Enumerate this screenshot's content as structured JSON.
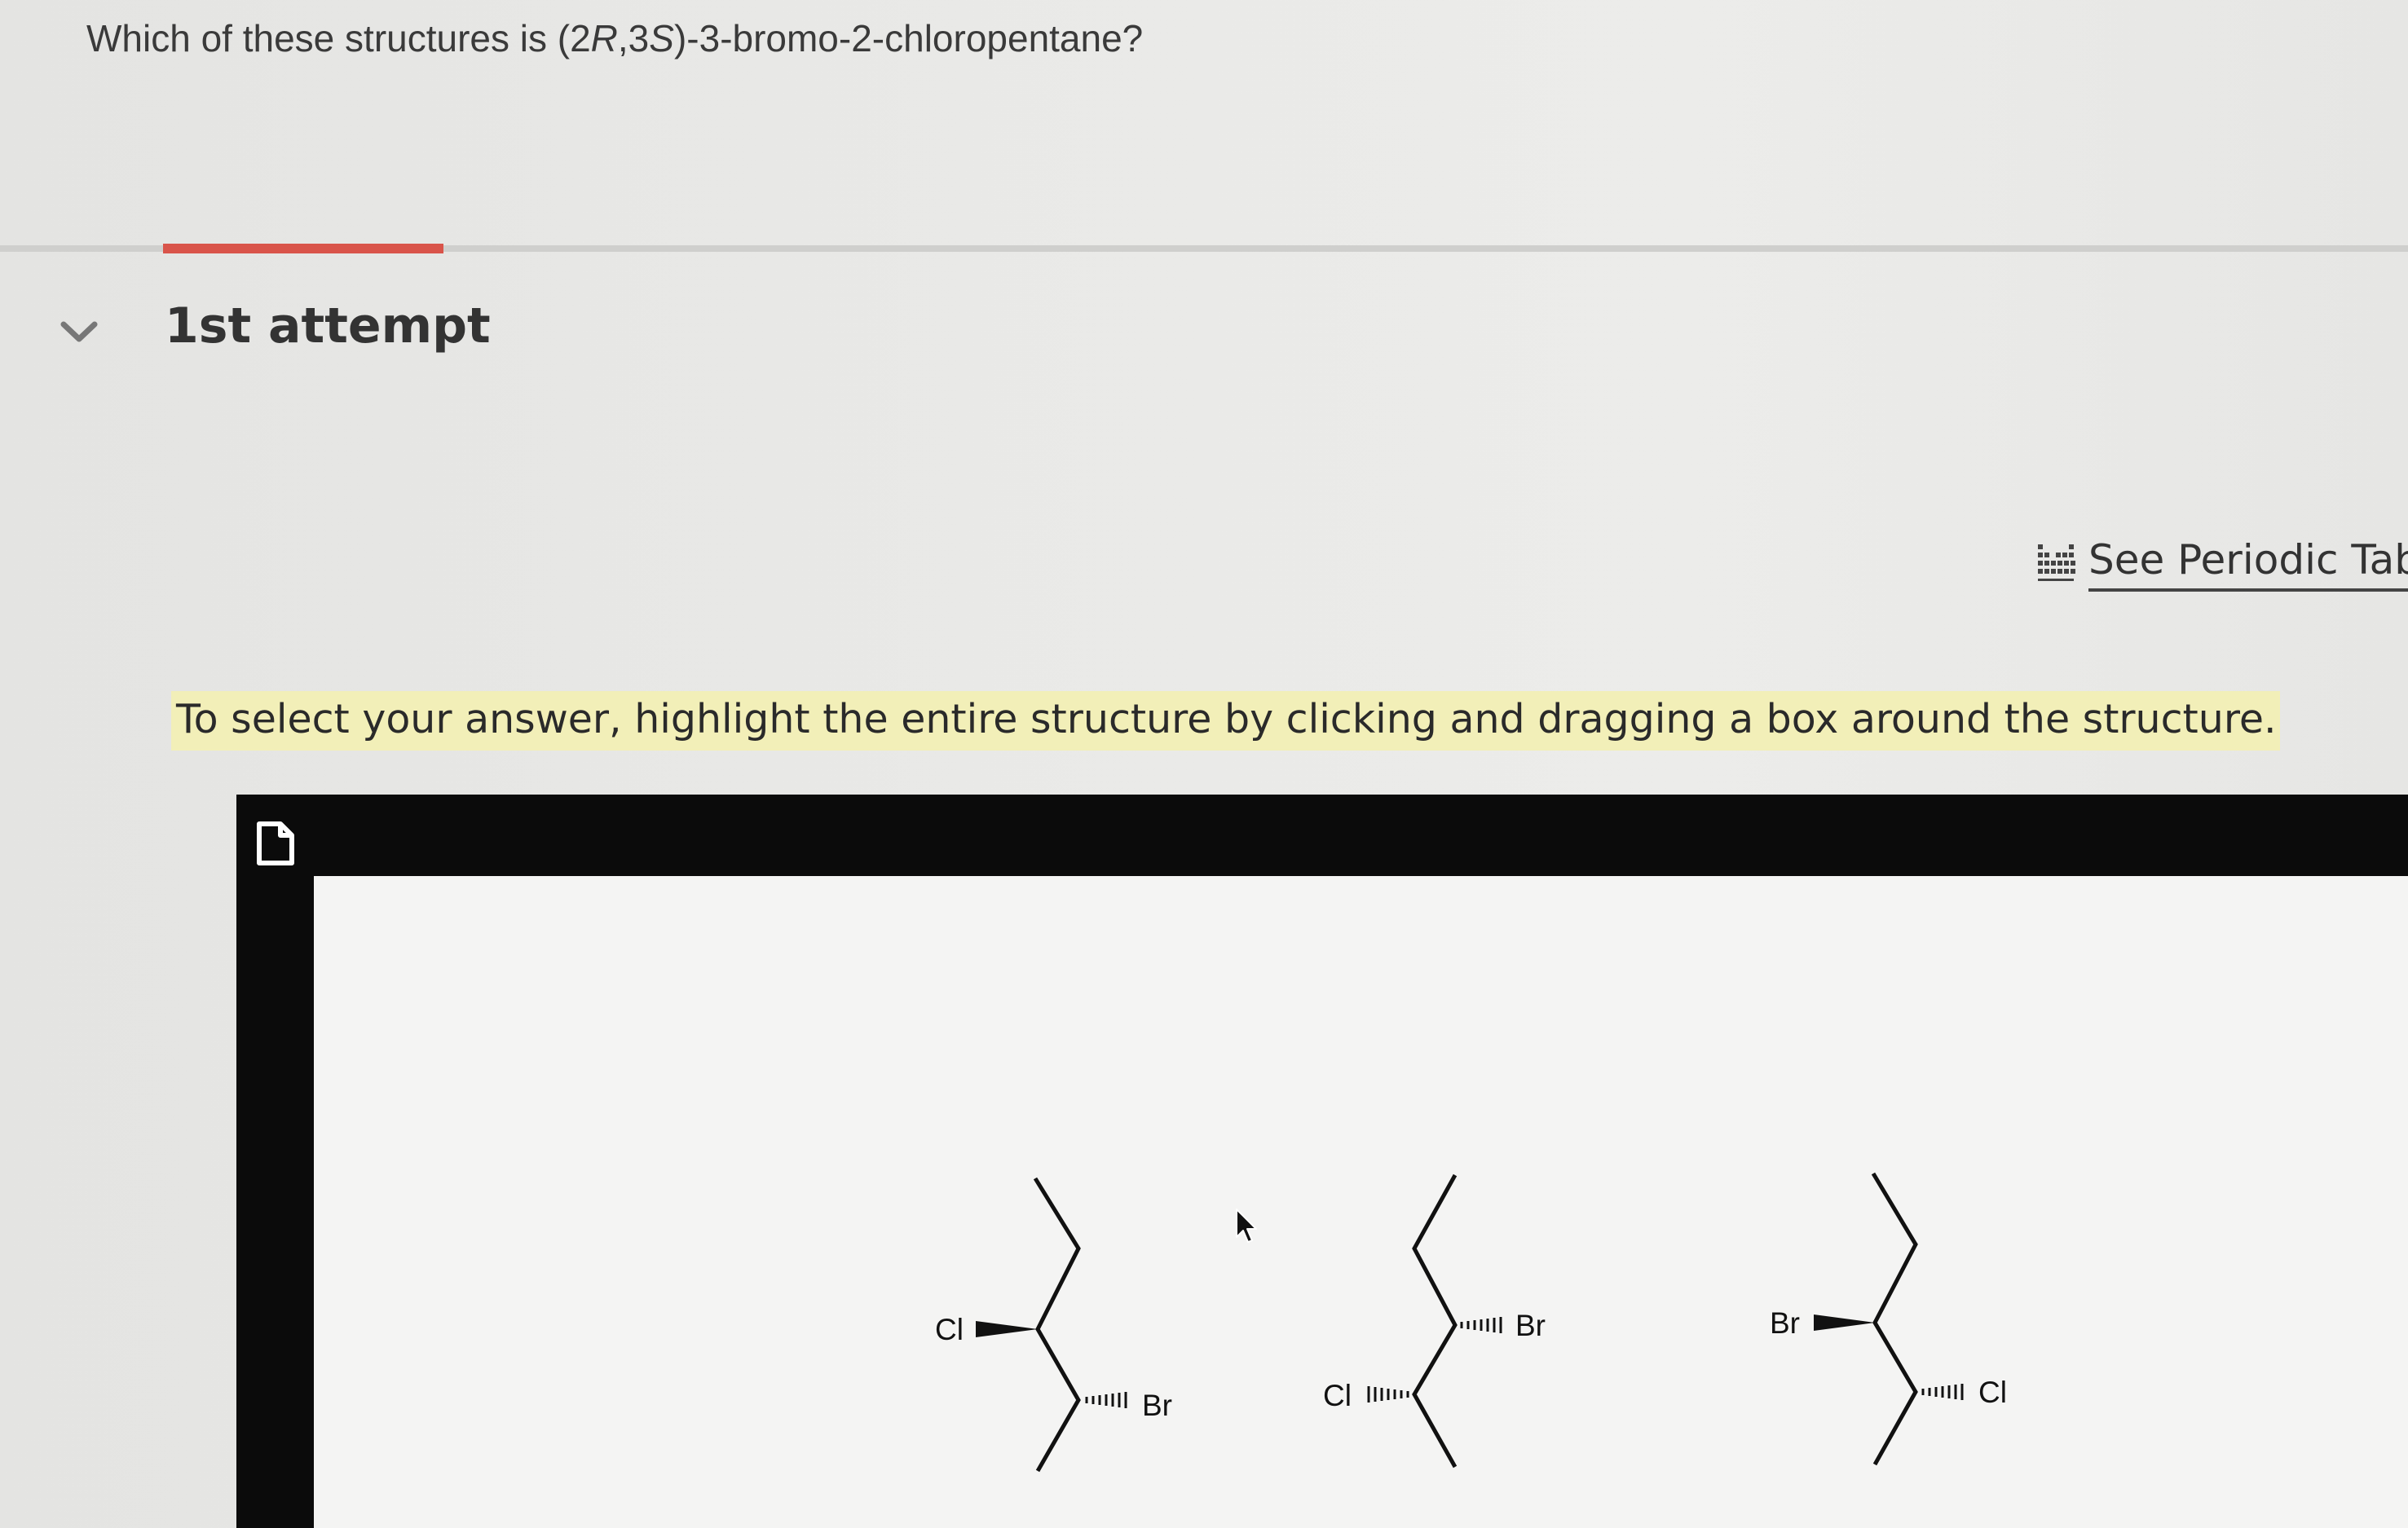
{
  "question": {
    "prefix": "Which of these structures is (2",
    "config1": "R",
    "middle": ",3",
    "config2": "S",
    "suffix": ")-3-bromo-2-chloropentane?"
  },
  "attempt": {
    "label": "1st attempt"
  },
  "periodic_table": {
    "label": "See Periodic Table",
    "icon": "periodic-table-icon"
  },
  "instruction": "To select your answer, highlight the entire structure by clicking and dragging a box around the structure.",
  "structures": [
    {
      "labels": [
        "Cl",
        "Br"
      ]
    },
    {
      "labels": [
        "Br",
        "Cl"
      ]
    },
    {
      "labels": [
        "Br",
        "Cl"
      ]
    }
  ],
  "colors": {
    "accent": "#d9544a",
    "highlight": "#f2efb8",
    "panel": "#0b0b0b"
  }
}
